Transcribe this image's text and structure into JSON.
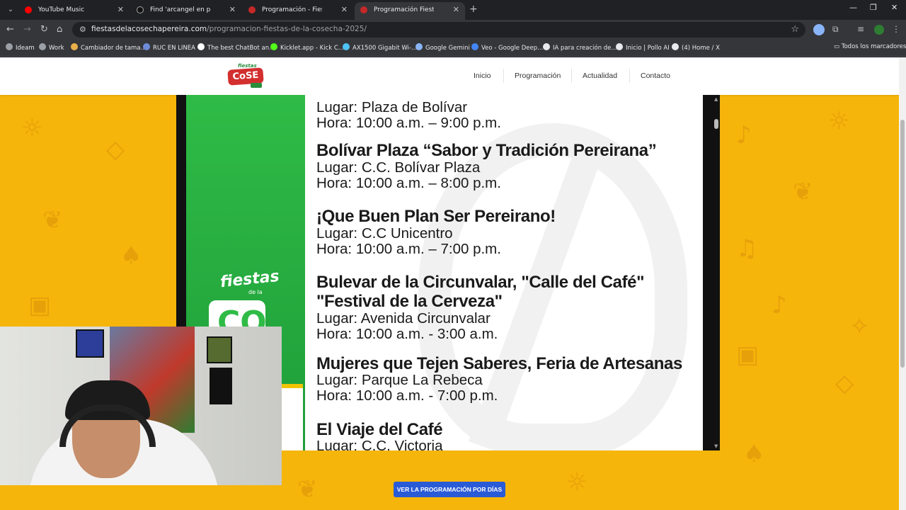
{
  "browser": {
    "tabs": [
      {
        "title": "YouTube Music",
        "color": "#ff0000",
        "active": false
      },
      {
        "title": "Find 'arcangel en pereira' on TikTok",
        "color": "#111111",
        "active": false
      },
      {
        "title": "Programación - Fiestas de la Cosecha",
        "color": "#c62828",
        "active": false
      },
      {
        "title": "Programación Fiestas de la Cosecha",
        "color": "#c62828",
        "active": true
      }
    ],
    "url_host": "fiestasdelacosechapereira.com",
    "url_path": "/programacion-fiestas-de-la-cosecha-2025/",
    "bookmarks": [
      {
        "label": "Ideam",
        "color": "#9aa0a6"
      },
      {
        "label": "Work",
        "color": "#9aa0a6"
      },
      {
        "label": "Cambiador de tama...",
        "color": "#e8b04a"
      },
      {
        "label": "RUC EN LINEA",
        "color": "#6d8bd6"
      },
      {
        "label": "The best ChatBot an...",
        "color": "#ffffff"
      },
      {
        "label": "Kicklet.app - Kick C...",
        "color": "#53fc18"
      },
      {
        "label": "AX1500 Gigabit Wi-...",
        "color": "#4fc3f7"
      },
      {
        "label": "Google Gemini",
        "color": "#8ab4f8"
      },
      {
        "label": "Veo - Google Deep...",
        "color": "#4285f4"
      },
      {
        "label": "IA para creación de...",
        "color": "#e8eaed"
      },
      {
        "label": "Inicio | Pollo AI",
        "color": "#e8eaed"
      },
      {
        "label": "(4) Home / X",
        "color": "#e8eaed"
      }
    ],
    "all_bookmarks": "Todos los marcadores"
  },
  "site": {
    "nav": [
      "Inicio",
      "Programación",
      "Actualidad",
      "Contacto"
    ],
    "logo_top": "fiestas",
    "logo_main": "CoSE"
  },
  "promo": {
    "word": "fiestas",
    "sub": "de la",
    "frag": "CO"
  },
  "events": [
    {
      "title": "Bolívar Plaza “Sabor y Tradición Pereirana”",
      "place": "Lugar: C.C. Bolívar Plaza",
      "hours": "Hora: 10:00 a.m. – 8:00 p.m."
    },
    {
      "title": "¡Que Buen Plan Ser Pereirano!",
      "place": "Lugar: C.C Unicentro",
      "hours": "Hora: 10:00 a.m. – 7:00 p.m."
    },
    {
      "title": "Bulevar de la Circunvalar, \"Calle del Café\"",
      "title2": "\"Festival de la Cerveza\"",
      "place": "Lugar: Avenida Circunvalar",
      "hours": "Hora: 10:00 a.m. - 3:00 a.m."
    },
    {
      "title": "Mujeres que Tejen Saberes, Feria de Artesanas",
      "place": "Lugar: Parque La Rebeca",
      "hours": "Hora: 10:00 a.m. - 7:00 p.m."
    },
    {
      "title": "El Viaje del Café",
      "place": "Lugar: C.C. Victoria"
    }
  ],
  "top_event": {
    "place": "Lugar: Plaza de Bolívar",
    "hours": "Hora: 10:00 a.m. – 9:00 p.m."
  },
  "cta_label": "VER LA PROGRAMACIÓN POR DÍAS",
  "colors": {
    "page_bg": "#f5b50a",
    "promo_green": "#2fbb46",
    "cta_blue": "#2a5bd7"
  }
}
